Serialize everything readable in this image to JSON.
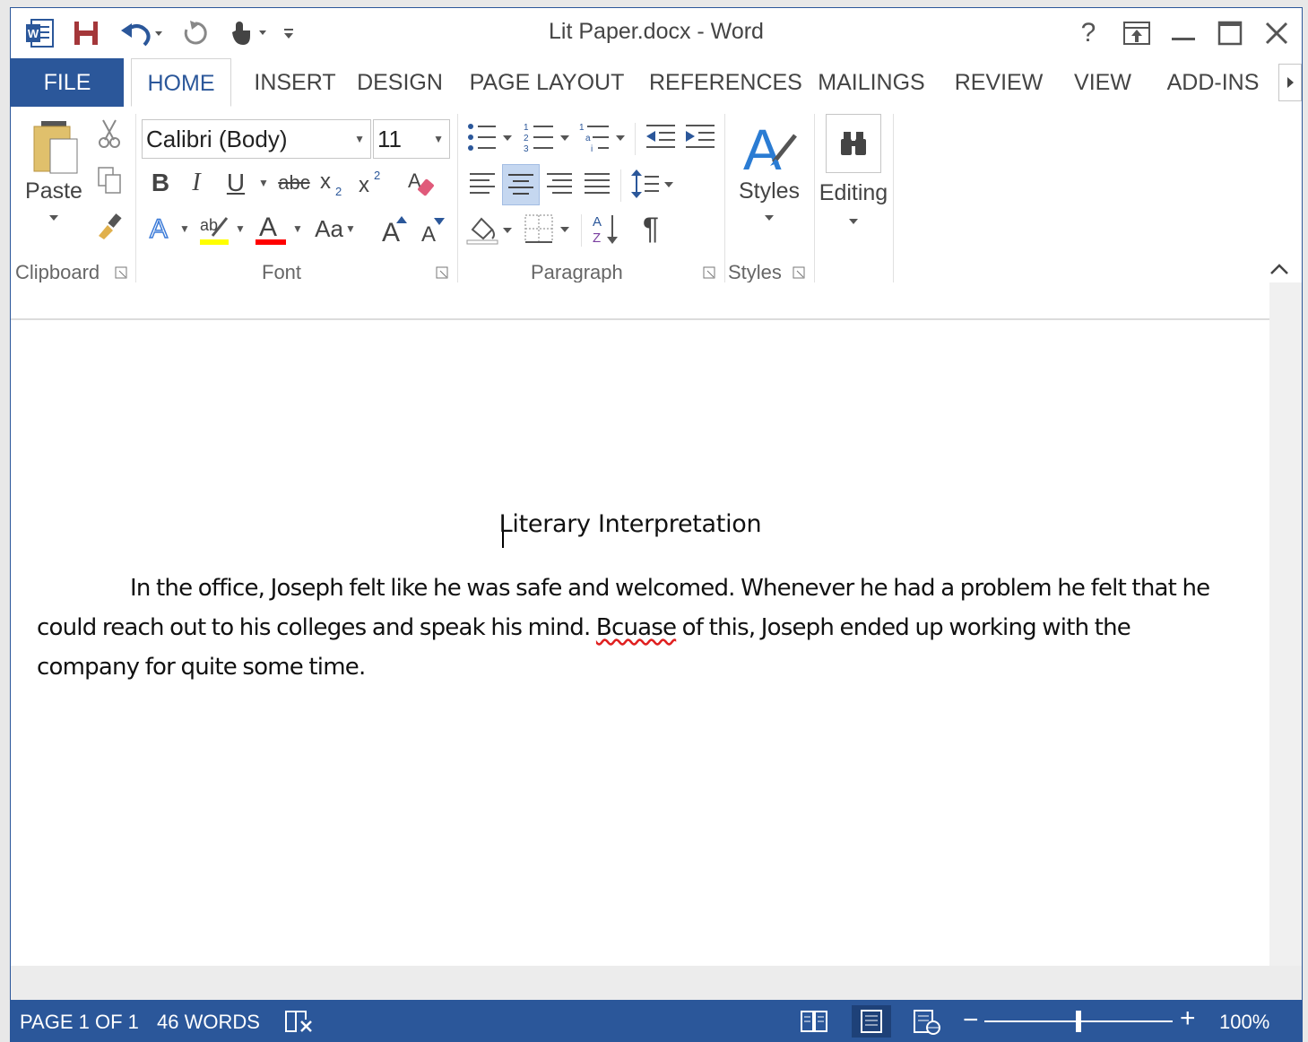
{
  "window": {
    "title": "Lit Paper.docx - Word"
  },
  "qat": {
    "icons": [
      "word-logo-icon",
      "save-icon",
      "undo-icon",
      "redo-icon",
      "touch-mode-icon",
      "customize-qat-icon"
    ]
  },
  "window_controls": {
    "help": "?",
    "icons": [
      "ribbon-display-options-icon",
      "minimize-icon",
      "maximize-icon",
      "close-icon"
    ]
  },
  "tabs": {
    "file": "FILE",
    "home": "HOME",
    "insert": "INSERT",
    "design": "DESIGN",
    "page_layout": "PAGE LAYOUT",
    "references": "REFERENCES",
    "mailings": "MAILINGS",
    "review": "REVIEW",
    "view": "VIEW",
    "add_ins": "ADD-INS"
  },
  "ribbon": {
    "clipboard": {
      "paste_label": "Paste",
      "group_label": "Clipboard"
    },
    "font": {
      "font_name": "Calibri (Body)",
      "font_size": "11",
      "bold": "B",
      "italic": "I",
      "underline": "U",
      "strikethrough": "abc",
      "change_case": "Aa",
      "group_label": "Font",
      "highlight_color": "#ffff00",
      "font_color": "#ff0000"
    },
    "paragraph": {
      "group_label": "Paragraph",
      "pilcrow": "¶"
    },
    "styles": {
      "styles_label": "Styles",
      "group_label": "Styles"
    },
    "editing": {
      "editing_label": "Editing"
    }
  },
  "document": {
    "title": "Literary Interpretation",
    "para_part1": "In the office, Joseph felt like he was safe and welcomed. Whenever he had a problem he felt that he could reach out to his colleges and speak his mind. ",
    "misspelled_word": "Bcuase",
    "para_part2": " of this, Joseph ended up working with the company for quite some time."
  },
  "status": {
    "page": "PAGE 1 OF 1",
    "words": "46 WORDS",
    "zoom": "100%"
  },
  "colors": {
    "accent": "#2b579a",
    "active_align_bg": "#c5d7f0"
  }
}
